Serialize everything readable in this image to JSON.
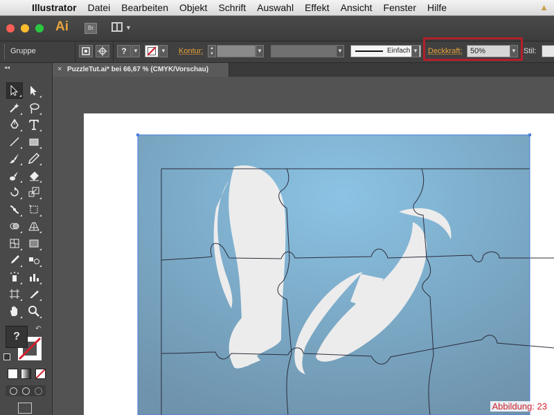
{
  "menubar": {
    "app_name": "Illustrator",
    "items": [
      "Datei",
      "Bearbeiten",
      "Objekt",
      "Schrift",
      "Auswahl",
      "Effekt",
      "Ansicht",
      "Fenster",
      "Hilfe"
    ]
  },
  "appbar": {
    "logo": "Ai",
    "bridge_label": "Br"
  },
  "control_bar": {
    "selection_label": "Gruppe",
    "question_mark": "?",
    "stroke_label": "Kontur:",
    "stroke_style": "Einfach",
    "opacity_label": "Deckkraft:",
    "opacity_value": "50%",
    "style_label": "Stil:"
  },
  "document_tab": {
    "title": "PuzzleTut.ai* bei 66,67 % (CMYK/Vorschau)",
    "close_icon": "×"
  },
  "tools_panel": {
    "collapse_icon": "◂◂",
    "fill_swatch_label": "?",
    "tools": [
      "selection-tool",
      "direct-selection-tool",
      "magic-wand-tool",
      "lasso-tool",
      "pen-tool",
      "type-tool",
      "line-segment-tool",
      "rectangle-tool",
      "paintbrush-tool",
      "pencil-tool",
      "blob-brush-tool",
      "eraser-tool",
      "rotate-tool",
      "scale-tool",
      "width-tool",
      "free-transform-tool",
      "shape-builder-tool",
      "perspective-grid-tool",
      "mesh-tool",
      "gradient-tool",
      "eyedropper-tool",
      "blend-tool",
      "symbol-sprayer-tool",
      "column-graph-tool",
      "artboard-tool",
      "slice-tool",
      "hand-tool",
      "zoom-tool"
    ]
  },
  "figure_label": "Abbildung: 23",
  "colors": {
    "accent": "#e8a33a",
    "highlight_frame": "#b41f2a",
    "selection": "#4a7fe0",
    "artwork_blue": "#7ea9c6"
  }
}
